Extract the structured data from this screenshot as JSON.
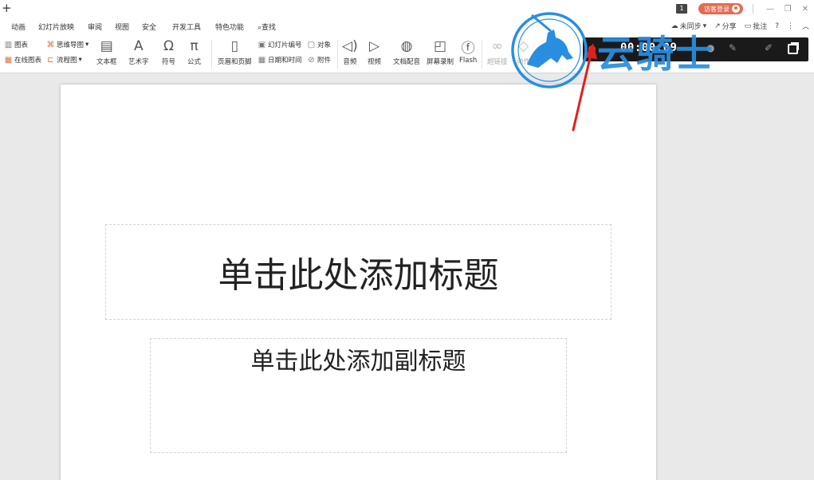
{
  "titlebar": {
    "new_tab_icon": "+",
    "page_badge": "1",
    "login_label": "访客登录"
  },
  "menubar": {
    "items": [
      "动画",
      "幻灯片放映",
      "审阅",
      "视图",
      "安全",
      "开发工具",
      "特色功能",
      "查找"
    ],
    "right": {
      "sync": "未同步",
      "share": "分享",
      "comment": "批注",
      "help": "?"
    }
  },
  "ribbon": {
    "chart": "图表",
    "mindmap": "思维导图",
    "online_chart": "在线图表",
    "flowchart": "流程图",
    "textbox": "文本框",
    "wordart": "艺术字",
    "symbol": "符号",
    "formula": "公式",
    "header_footer": "页眉和页脚",
    "slide_number": "幻灯片编号",
    "object": "对象",
    "datetime": "日期和时间",
    "attachment": "附件",
    "audio": "音频",
    "video": "视频",
    "doc_dub": "文档配音",
    "screen_record": "屏幕录制",
    "flash": "Flash",
    "hyperlink": "超链接",
    "action": "动作"
  },
  "recording": {
    "time": "00:00:09"
  },
  "watermark": {
    "text": "云骑士"
  },
  "slide": {
    "title_placeholder": "单击此处添加标题",
    "subtitle_placeholder": "单击此处添加副标题"
  },
  "colors": {
    "accent": "#e46b51",
    "record_bar": "#1a1a1a",
    "watermark_blue": "#2a8ee0",
    "arrow_red": "#e02020"
  }
}
